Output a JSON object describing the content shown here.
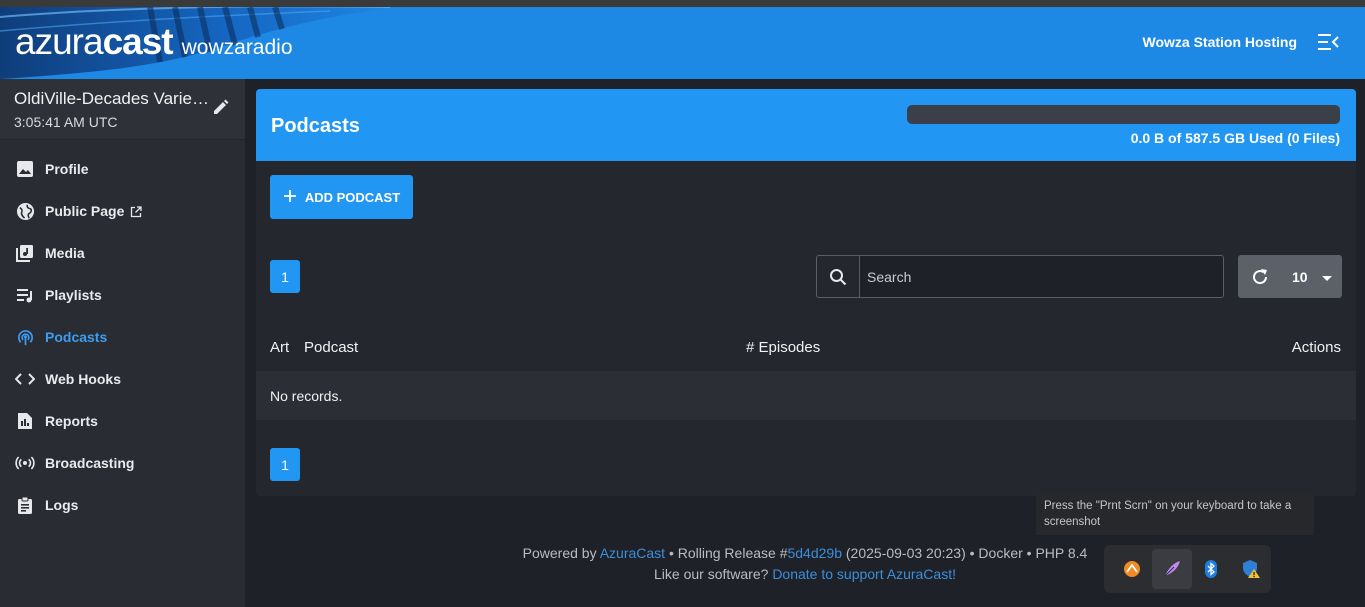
{
  "navbar": {
    "brand_light": "azura",
    "brand_bold": "cast",
    "station_short": "wowzaradio",
    "station_link": "Wowza Station Hosting",
    "menu_icon": "menu-collapse-icon"
  },
  "sidebar": {
    "station_name": "OldiVille-Decades Varie…",
    "station_time": "3:05:41 AM UTC",
    "items": [
      {
        "label": "Profile",
        "icon": "image-icon"
      },
      {
        "label": "Public Page",
        "icon": "globe-icon"
      },
      {
        "label": "Media",
        "icon": "music-library-icon"
      },
      {
        "label": "Playlists",
        "icon": "playlist-icon"
      },
      {
        "label": "Podcasts",
        "icon": "podcast-icon",
        "active": true
      },
      {
        "label": "Web Hooks",
        "icon": "code-icon"
      },
      {
        "label": "Reports",
        "icon": "report-icon"
      },
      {
        "label": "Broadcasting",
        "icon": "broadcast-icon"
      },
      {
        "label": "Logs",
        "icon": "clipboard-icon"
      }
    ]
  },
  "main": {
    "title": "Podcasts",
    "quota_text": "0.0 B of 587.5 GB Used (0 Files)",
    "quota_fraction": 0,
    "add_button": "ADD PODCAST",
    "page_top": "1",
    "page_bottom": "1",
    "search_placeholder": "Search",
    "per_page": "10",
    "columns": [
      "Art",
      "Podcast",
      "# Episodes",
      "Actions"
    ],
    "empty_text": "No records."
  },
  "footer": {
    "powered_by": "Powered by",
    "azuracast_link": "AzuraCast",
    "release_text": "• Rolling Release #",
    "commit": "5d4d29b",
    "release_rest": "(2025-09-03 20:23) • Docker • PHP 8.4",
    "like_text": "Like our software?",
    "donate_link": "Donate to support AzuraCast!"
  },
  "taskbar": {
    "tooltip": "Press the \"Prnt Scrn\" on your keyboard to take a screenshot"
  },
  "colors": {
    "accent": "#2196f3",
    "navbar": "#1e88e5",
    "sidebar": "#2a2c33",
    "background": "#1f2128",
    "active_nav": "#3b9cf0"
  }
}
